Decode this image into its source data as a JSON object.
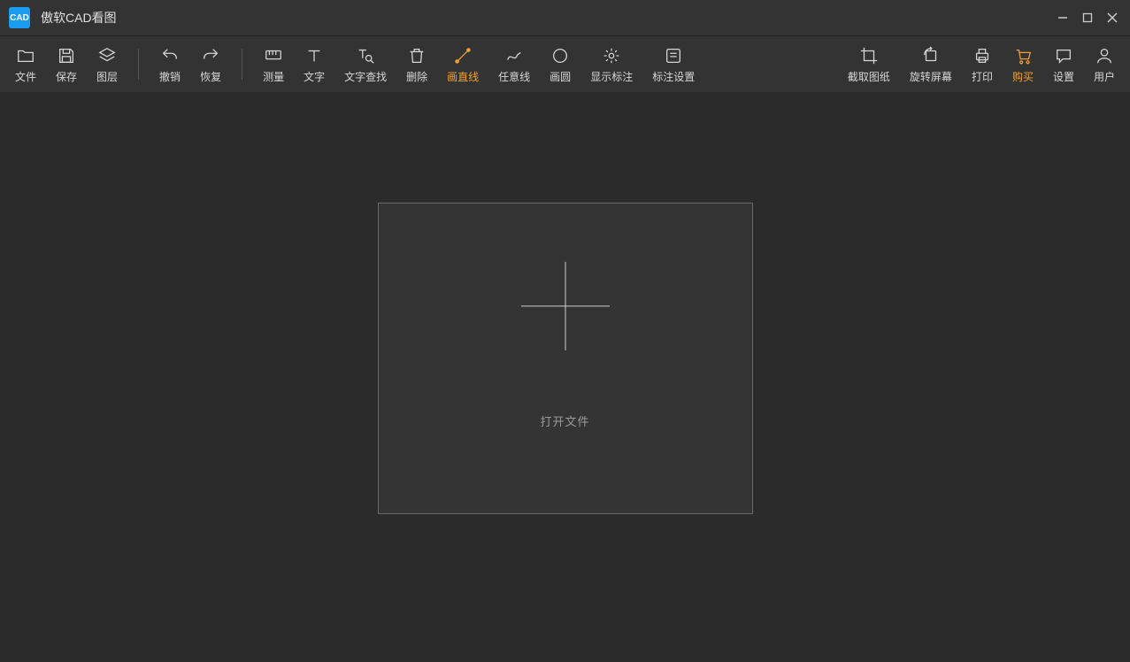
{
  "app": {
    "icon_text": "CAD",
    "title": "傲软CAD看图"
  },
  "window_controls": {
    "minimize": "minimize",
    "maximize": "maximize",
    "close": "close"
  },
  "toolbar": {
    "groups": [
      {
        "type": "btn",
        "key": "file",
        "label": "文件",
        "icon": "folder-icon"
      },
      {
        "type": "btn",
        "key": "save",
        "label": "保存",
        "icon": "save-icon"
      },
      {
        "type": "btn",
        "key": "layers",
        "label": "图层",
        "icon": "layers-icon"
      },
      {
        "type": "div"
      },
      {
        "type": "btn",
        "key": "undo",
        "label": "撤销",
        "icon": "undo-icon"
      },
      {
        "type": "btn",
        "key": "redo",
        "label": "恢复",
        "icon": "redo-icon"
      },
      {
        "type": "div"
      },
      {
        "type": "btn",
        "key": "measure",
        "label": "测量",
        "icon": "measure-icon"
      },
      {
        "type": "btn",
        "key": "text",
        "label": "文字",
        "icon": "text-icon"
      },
      {
        "type": "btn",
        "key": "textfind",
        "label": "文字查找",
        "icon": "text-find-icon"
      },
      {
        "type": "btn",
        "key": "delete",
        "label": "删除",
        "icon": "trash-icon"
      },
      {
        "type": "btn",
        "key": "line",
        "label": "画直线",
        "icon": "line-icon",
        "accent": true
      },
      {
        "type": "btn",
        "key": "freeline",
        "label": "任意线",
        "icon": "freeline-icon"
      },
      {
        "type": "btn",
        "key": "circle",
        "label": "画圆",
        "icon": "circle-icon"
      },
      {
        "type": "btn",
        "key": "showannot",
        "label": "显示标注",
        "icon": "show-annot-icon"
      },
      {
        "type": "btn",
        "key": "annotset",
        "label": "标注设置",
        "icon": "annot-settings-icon"
      },
      {
        "type": "flex"
      },
      {
        "type": "btn",
        "key": "screenshot",
        "label": "截取图纸",
        "icon": "crop-icon"
      },
      {
        "type": "btn",
        "key": "rotate",
        "label": "旋转屏幕",
        "icon": "rotate-icon"
      },
      {
        "type": "btn",
        "key": "print",
        "label": "打印",
        "icon": "print-icon"
      },
      {
        "type": "btn",
        "key": "buy",
        "label": "购买",
        "icon": "cart-icon",
        "accent": true
      },
      {
        "type": "btn",
        "key": "settings",
        "label": "设置",
        "icon": "chat-icon"
      },
      {
        "type": "btn",
        "key": "user",
        "label": "用户",
        "icon": "user-icon"
      }
    ]
  },
  "main": {
    "open_label": "打开文件"
  }
}
